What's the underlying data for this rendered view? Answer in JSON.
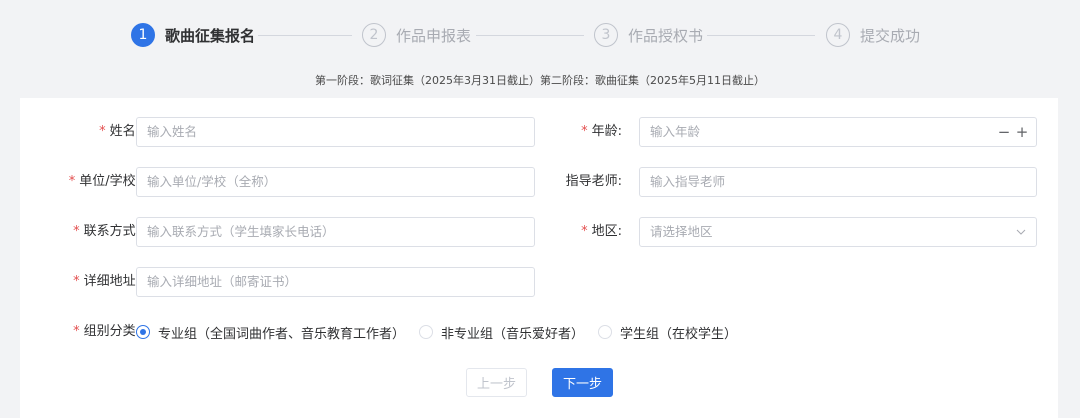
{
  "steps": [
    {
      "number": "1",
      "label": "歌曲征集报名",
      "active": true
    },
    {
      "number": "2",
      "label": "作品申报表",
      "active": false
    },
    {
      "number": "3",
      "label": "作品授权书",
      "active": false
    },
    {
      "number": "4",
      "label": "提交成功",
      "active": false
    }
  ],
  "stage_note": "第一阶段：歌词征集（2025年3月31日截止）第二阶段：歌曲征集（2025年5月11日截止）",
  "form": {
    "required_mark": "*",
    "name": {
      "label": "姓名:",
      "placeholder": "输入姓名"
    },
    "age": {
      "label": "年龄:",
      "placeholder": "输入年龄",
      "minus": "−",
      "plus": "+"
    },
    "unit": {
      "label": "单位/学校:",
      "placeholder": "输入单位/学校（全称）"
    },
    "teacher": {
      "label": "指导老师:",
      "placeholder": "输入指导老师"
    },
    "contact": {
      "label": "联系方式:",
      "placeholder": "输入联系方式（学生填家长电话）"
    },
    "region": {
      "label": "地区:",
      "placeholder": "请选择地区"
    },
    "address": {
      "label": "详细地址:",
      "placeholder": "输入详细地址（邮寄证书）"
    },
    "group": {
      "label": "组别分类:",
      "options": [
        {
          "label": "专业组（全国词曲作者、音乐教育工作者）",
          "checked": true
        },
        {
          "label": "非专业组（音乐爱好者）",
          "checked": false
        },
        {
          "label": "学生组（在校学生）",
          "checked": false
        }
      ]
    }
  },
  "buttons": {
    "prev": "上一步",
    "next": "下一步"
  },
  "colors": {
    "primary": "#2f74e6",
    "required": "#e34d4d"
  }
}
